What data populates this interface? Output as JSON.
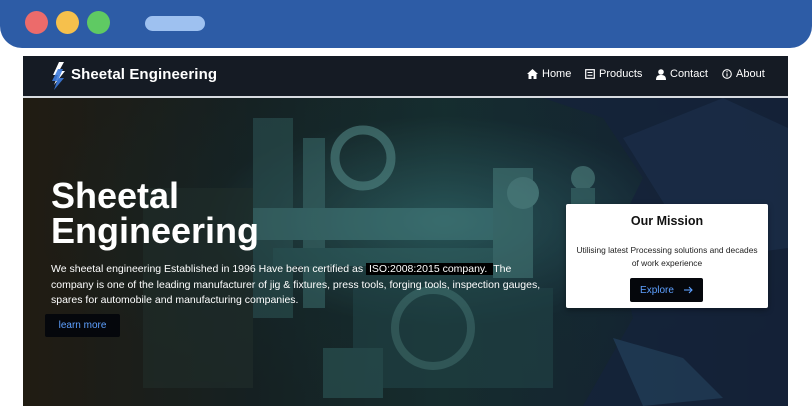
{
  "navbar": {
    "brand": "Sheetal Engineering",
    "items": [
      {
        "label": "Home",
        "icon": "home-icon"
      },
      {
        "label": "Products",
        "icon": "products-icon"
      },
      {
        "label": "Contact",
        "icon": "user-icon"
      },
      {
        "label": "About",
        "icon": "info-icon"
      }
    ]
  },
  "hero": {
    "title_line1": "Sheetal",
    "title_line2": "Engineering",
    "text_before": "We sheetal engineering Established in 1996 Have been certified as ",
    "iso_text": "ISO:2008:2015 company. ",
    "text_after": " The company is one of the leading manufacturer of jig & fixtures, press tools, forging tools, inspection gauges, spares for automobile and manufacturing companies.",
    "learn_more_label": "learn more"
  },
  "mission": {
    "title": "Our Mission",
    "text": "Utilising latest Processing solutions and decades of work experience",
    "explore_label": "Explore"
  },
  "colors": {
    "chrome_bar": "#2d5ca6",
    "navbar_bg": "#151b24",
    "button_text": "#5ea0ff",
    "button_bg": "#05070c"
  }
}
